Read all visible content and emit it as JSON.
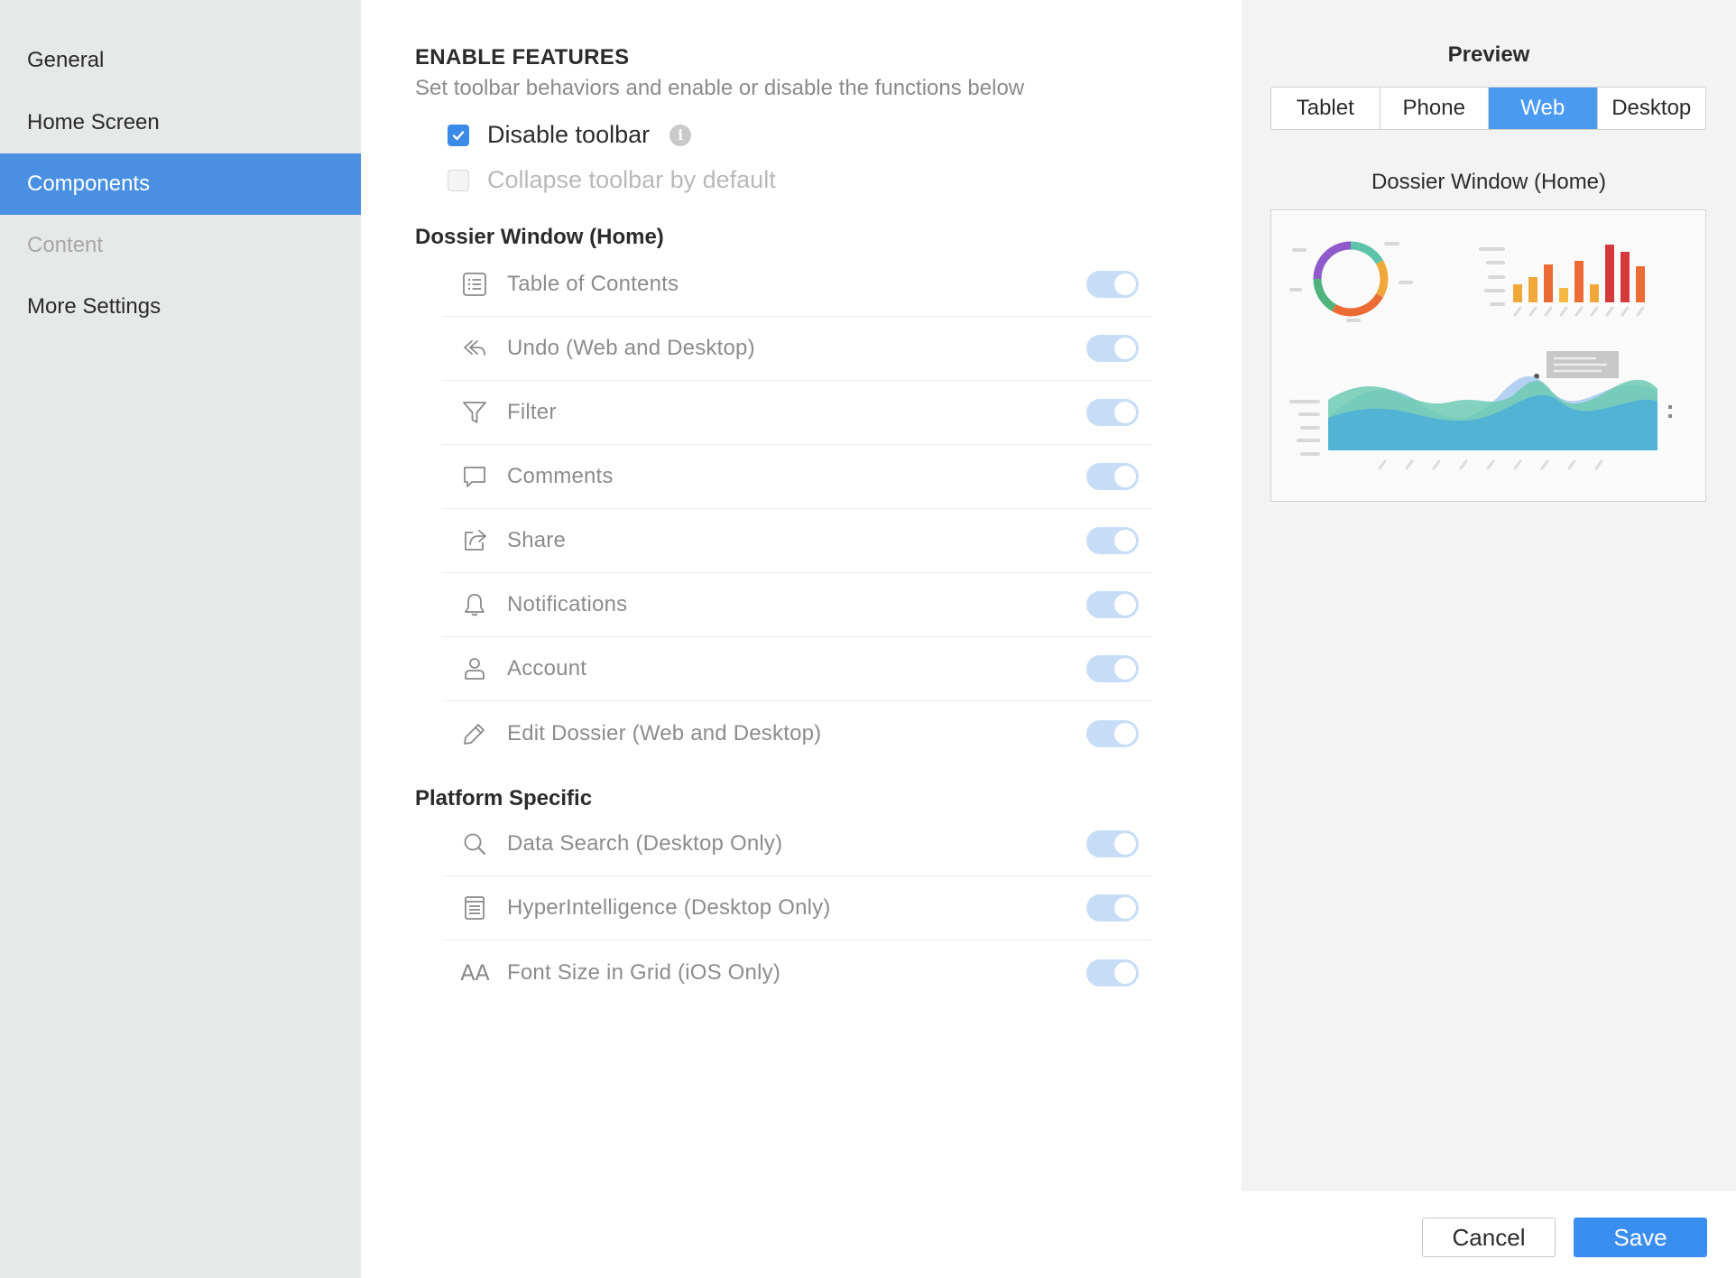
{
  "sidebar": {
    "items": [
      {
        "label": "General",
        "state": "normal"
      },
      {
        "label": "Home Screen",
        "state": "normal"
      },
      {
        "label": "Components",
        "state": "active"
      },
      {
        "label": "Content",
        "state": "disabled"
      },
      {
        "label": "More Settings",
        "state": "normal"
      }
    ]
  },
  "main": {
    "title": "ENABLE FEATURES",
    "subtitle": "Set toolbar behaviors and enable or disable the functions below",
    "disable_toolbar": {
      "label": "Disable toolbar",
      "checked": true,
      "info_icon": "i"
    },
    "collapse_toolbar": {
      "label": "Collapse toolbar by default",
      "checked": false
    },
    "dossier_window": {
      "title": "Dossier Window (Home)",
      "items": [
        {
          "label": "Table of Contents",
          "icon": "table-of-contents-icon",
          "enabled": true
        },
        {
          "label": "Undo (Web and Desktop)",
          "icon": "undo-icon",
          "enabled": true
        },
        {
          "label": "Filter",
          "icon": "filter-icon",
          "enabled": true
        },
        {
          "label": "Comments",
          "icon": "comments-icon",
          "enabled": true
        },
        {
          "label": "Share",
          "icon": "share-icon",
          "enabled": true
        },
        {
          "label": "Notifications",
          "icon": "bell-icon",
          "enabled": true
        },
        {
          "label": "Account",
          "icon": "account-icon",
          "enabled": true
        },
        {
          "label": "Edit Dossier (Web and Desktop)",
          "icon": "pencil-icon",
          "enabled": true
        }
      ]
    },
    "platform_specific": {
      "title": "Platform Specific",
      "items": [
        {
          "label": "Data Search (Desktop Only)",
          "icon": "search-icon",
          "enabled": true
        },
        {
          "label": "HyperIntelligence (Desktop Only)",
          "icon": "hyperintelligence-icon",
          "enabled": true
        },
        {
          "label": "Font Size in Grid (iOS Only)",
          "icon": "font-size-icon",
          "enabled": true
        }
      ],
      "font_size_icon_text": "AA"
    }
  },
  "preview": {
    "title": "Preview",
    "tabs": [
      "Tablet",
      "Phone",
      "Web",
      "Desktop"
    ],
    "active_tab": "Web",
    "subtitle": "Dossier Window (Home)"
  },
  "footer": {
    "cancel_label": "Cancel",
    "save_label": "Save"
  },
  "colors": {
    "accent": "#4a90e2",
    "toggle_disabled_on": "#c7ddf7",
    "sidebar_bg": "#e7e8e8",
    "preview_bg": "#f3f3f3"
  }
}
